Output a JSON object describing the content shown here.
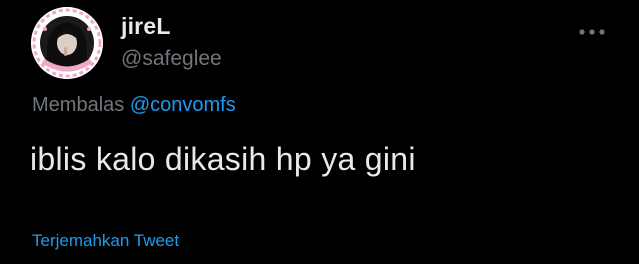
{
  "user": {
    "display_name": "jireL",
    "handle": "@safeglee"
  },
  "reply": {
    "prefix": "Membalas",
    "mention": "@convomfs"
  },
  "tweet": {
    "text": "iblis kalo dikasih hp ya gini"
  },
  "actions": {
    "translate": "Terjemahkan Tweet",
    "more_icon": "more-horizontal-icon"
  },
  "colors": {
    "background": "#000000",
    "primary_text": "#e7e9ea",
    "secondary_text": "#71767b",
    "accent": "#1d9bf0",
    "avatar_frame": "#f0a8c8"
  }
}
